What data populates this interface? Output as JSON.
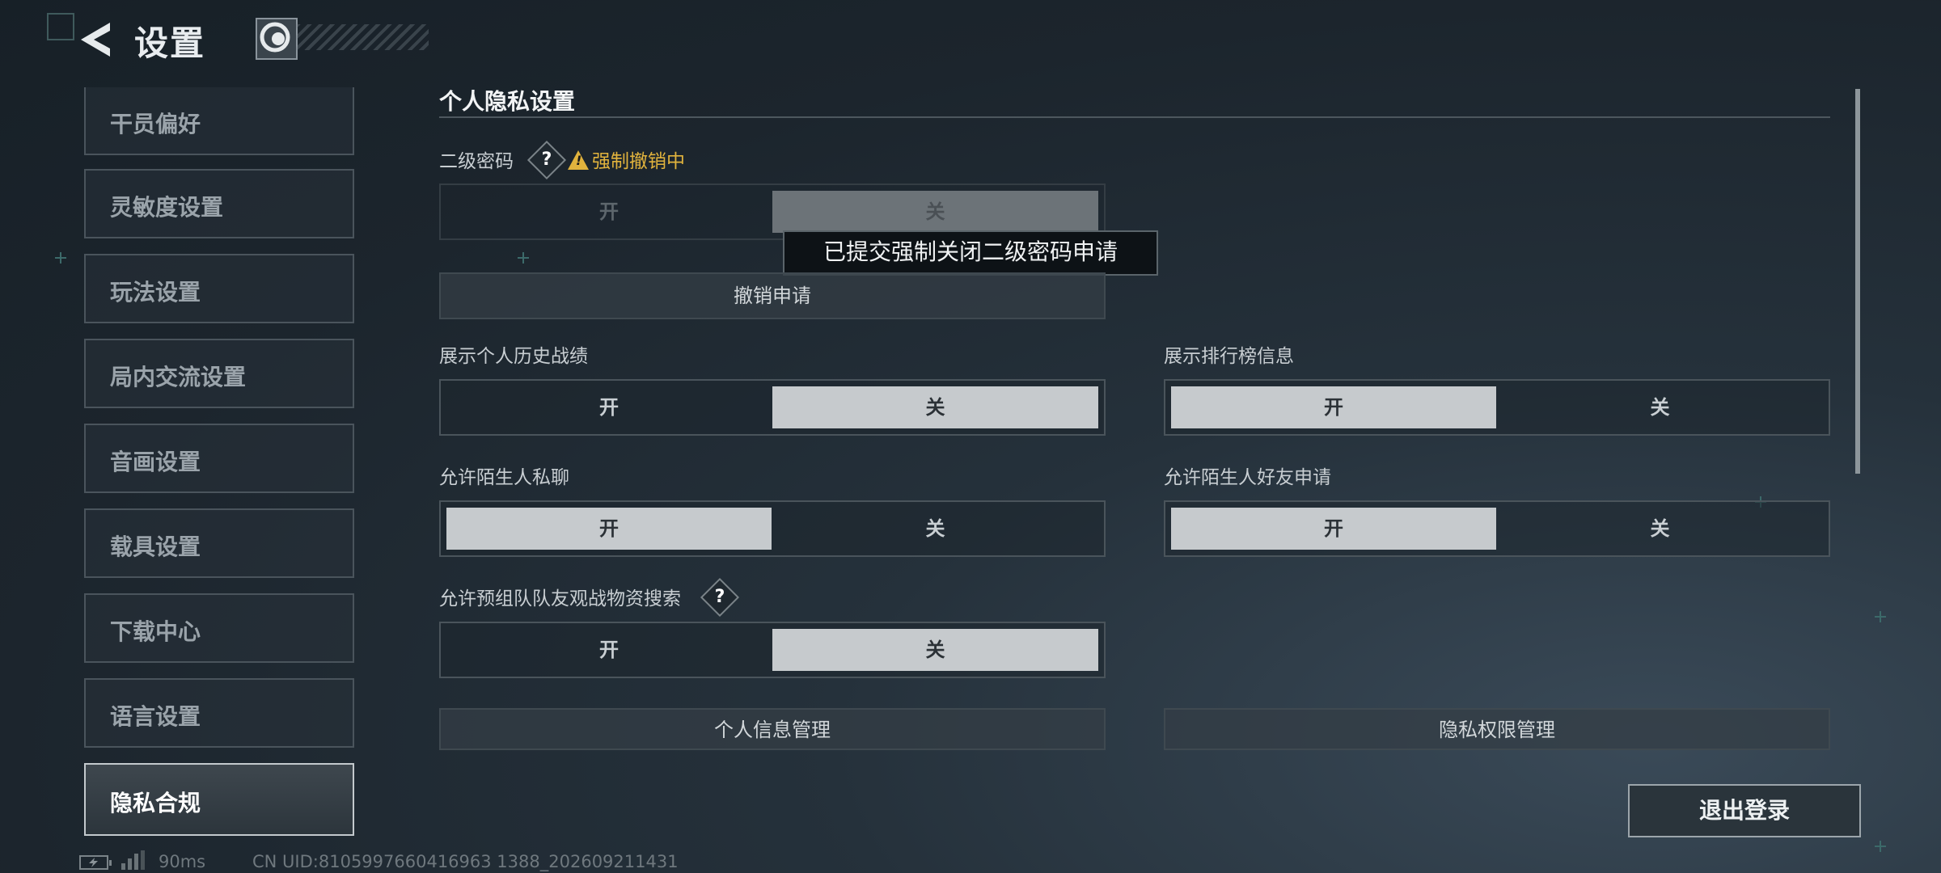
{
  "header": {
    "title": "设置"
  },
  "sidebar": {
    "items": [
      {
        "label": "干员偏好"
      },
      {
        "label": "灵敏度设置"
      },
      {
        "label": "玩法设置"
      },
      {
        "label": "局内交流设置"
      },
      {
        "label": "音画设置"
      },
      {
        "label": "载具设置"
      },
      {
        "label": "下载中心"
      },
      {
        "label": "语言设置"
      },
      {
        "label": "隐私合规",
        "active": true
      }
    ]
  },
  "privacy": {
    "section_title": "个人隐私设置",
    "secondary_password": {
      "label": "二级密码",
      "help_glyph": "?",
      "warning": "强制撤销中",
      "on_label": "开",
      "off_label": "关",
      "selected": "关",
      "disabled": true,
      "tooltip": "已提交强制关闭二级密码申请",
      "cancel_button": "撤销申请"
    },
    "show_history": {
      "label": "展示个人历史战绩",
      "on_label": "开",
      "off_label": "关",
      "selected": "关"
    },
    "show_leaderboard": {
      "label": "展示排行榜信息",
      "on_label": "开",
      "off_label": "关",
      "selected": "开"
    },
    "stranger_chat": {
      "label": "允许陌生人私聊",
      "on_label": "开",
      "off_label": "关",
      "selected": "开"
    },
    "stranger_friend": {
      "label": "允许陌生人好友申请",
      "on_label": "开",
      "off_label": "关",
      "selected": "开"
    },
    "team_spectate": {
      "label": "允许预组队队友观战物资搜索",
      "help_glyph": "?",
      "on_label": "开",
      "off_label": "关",
      "selected": "关"
    },
    "personal_info_button": "个人信息管理",
    "privacy_permission_button": "隐私权限管理"
  },
  "logout_button": "退出登录",
  "status_bar": {
    "ping": "90ms",
    "uid": "CN UID:8105997660416963 1388_202609211431"
  },
  "colors": {
    "accent_warning": "#e1b33d",
    "toggle_on": "#c6cacd"
  }
}
